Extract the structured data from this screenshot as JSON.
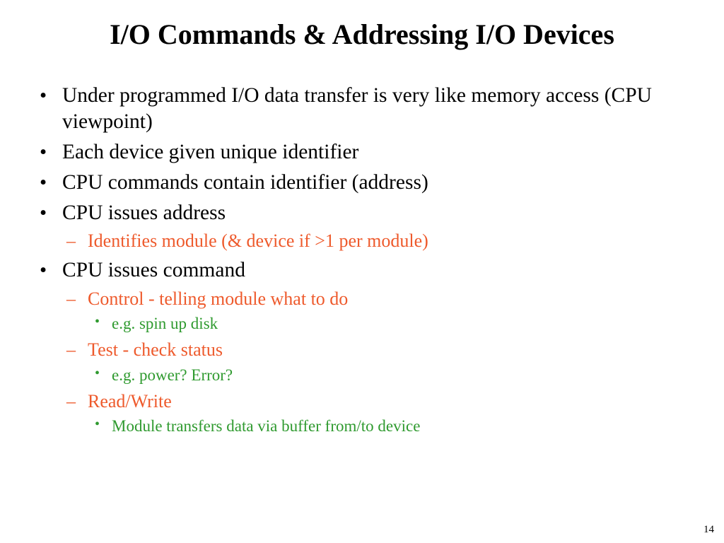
{
  "title": "I/O Commands & Addressing I/O Devices",
  "bullets": {
    "b0": "Under programmed I/O data transfer is very like memory access (CPU viewpoint)",
    "b1": "Each device given unique identifier",
    "b2": "CPU commands contain identifier (address)",
    "b3": "CPU issues address",
    "b3_sub0": "Identifies module (& device if >1 per module)",
    "b4": "CPU issues command",
    "b4_sub0": "Control - telling module what to do",
    "b4_sub0_sub0": "e.g. spin up disk",
    "b4_sub1": "Test - check status",
    "b4_sub1_sub0": "e.g. power? Error?",
    "b4_sub2": "Read/Write",
    "b4_sub2_sub0": "Module transfers data via buffer from/to device"
  },
  "page_number": "14"
}
